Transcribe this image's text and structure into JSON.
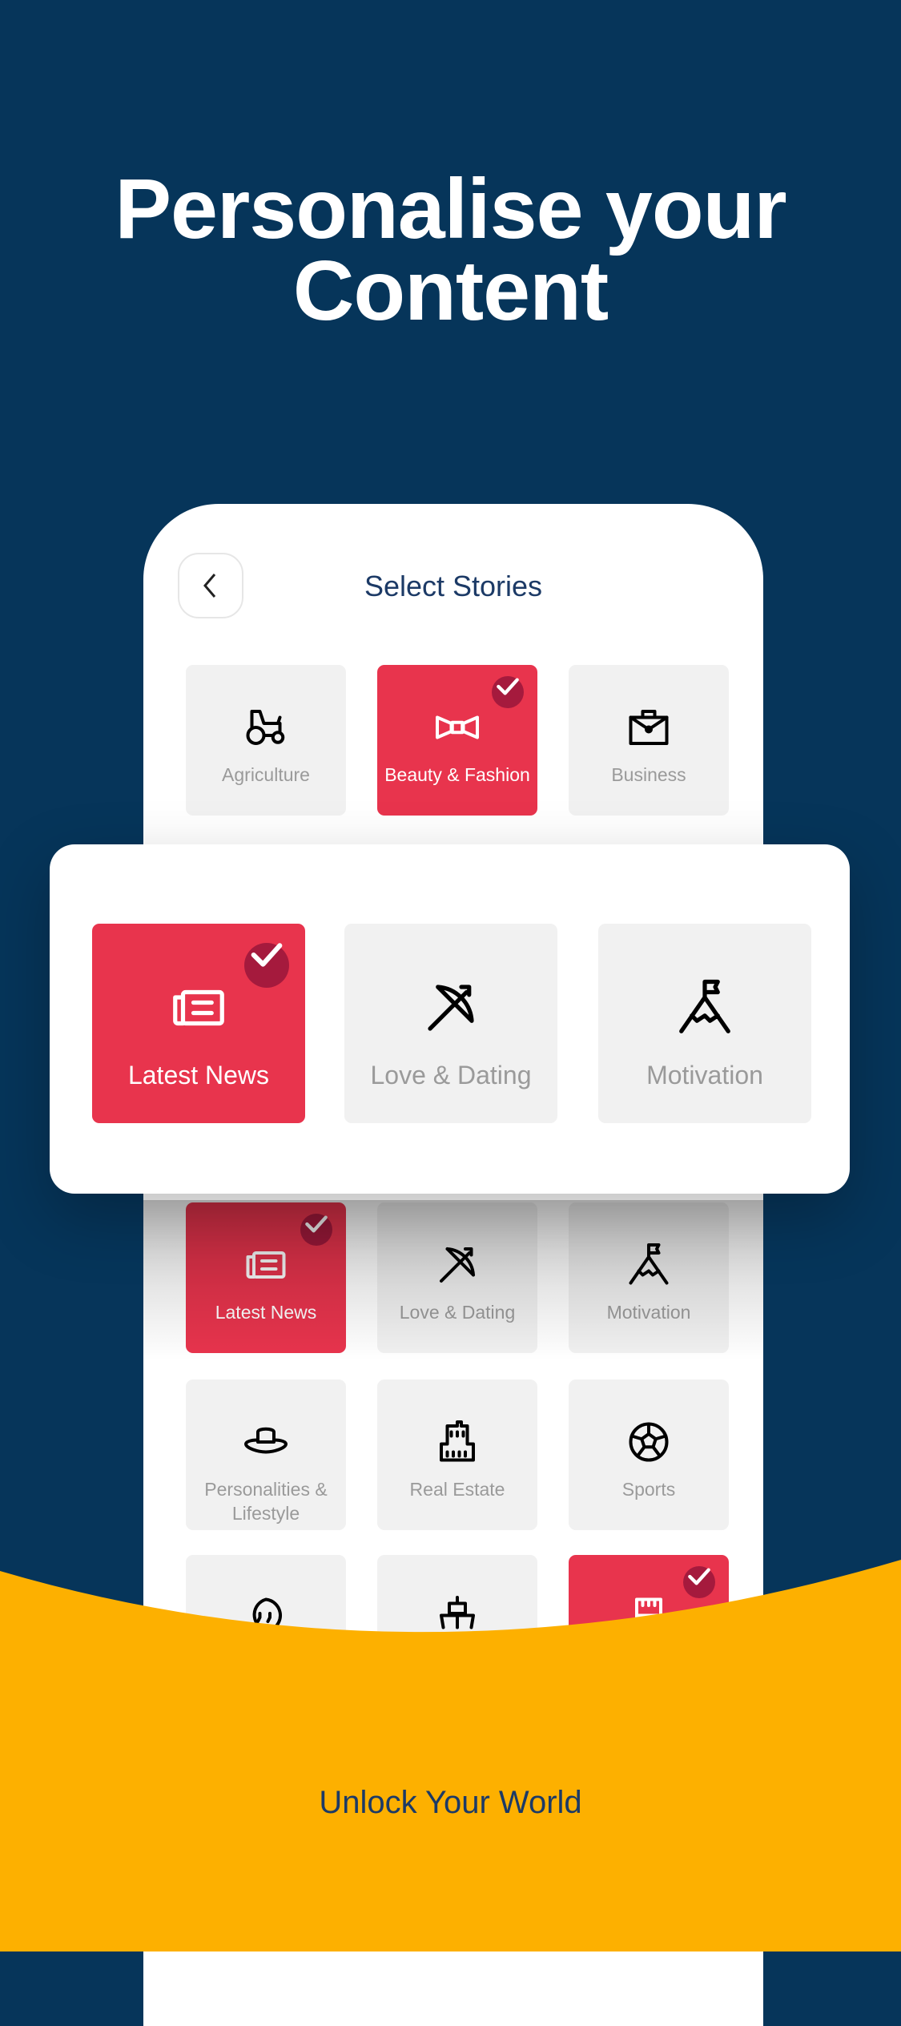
{
  "headline": {
    "line1": "Personalise your",
    "line2": "Content"
  },
  "colors": {
    "background": "#06355a",
    "selected": "#e8344d",
    "check_badge": "#a51a3d",
    "tile": "#f1f1f1",
    "accent_yellow": "#fdb000",
    "title": "#1c3a66"
  },
  "screen": {
    "title": "Select Stories",
    "back_icon": "chevron-left-icon",
    "top_row": [
      {
        "label": "Agriculture",
        "icon": "tractor",
        "selected": false
      },
      {
        "label": "Beauty & Fashion",
        "icon": "bow-tie",
        "selected": true
      },
      {
        "label": "Business",
        "icon": "briefcase",
        "selected": false
      }
    ],
    "grid": [
      {
        "label": "Latest News",
        "icon": "newspaper",
        "selected": true
      },
      {
        "label": "Love & Dating",
        "icon": "bow-arrow",
        "selected": false
      },
      {
        "label": "Motivation",
        "icon": "mountain-flag",
        "selected": false
      },
      {
        "label": "Personalities & Lifestyle",
        "icon": "hat",
        "selected": false
      },
      {
        "label": "Real Estate",
        "icon": "building",
        "selected": false
      },
      {
        "label": "Sports",
        "icon": "soccer-ball",
        "selected": false
      },
      {
        "label": "",
        "icon": "quote-bubble",
        "selected": false
      },
      {
        "label": "",
        "icon": "ship",
        "selected": false
      },
      {
        "label": "",
        "icon": "raised-fist",
        "selected": true
      }
    ]
  },
  "popup": {
    "items": [
      {
        "label": "Latest News",
        "icon": "newspaper",
        "selected": true
      },
      {
        "label": "Love & Dating",
        "icon": "bow-arrow",
        "selected": false
      },
      {
        "label": "Motivation",
        "icon": "mountain-flag",
        "selected": false
      }
    ]
  },
  "footer": {
    "tagline": "Unlock Your World"
  }
}
